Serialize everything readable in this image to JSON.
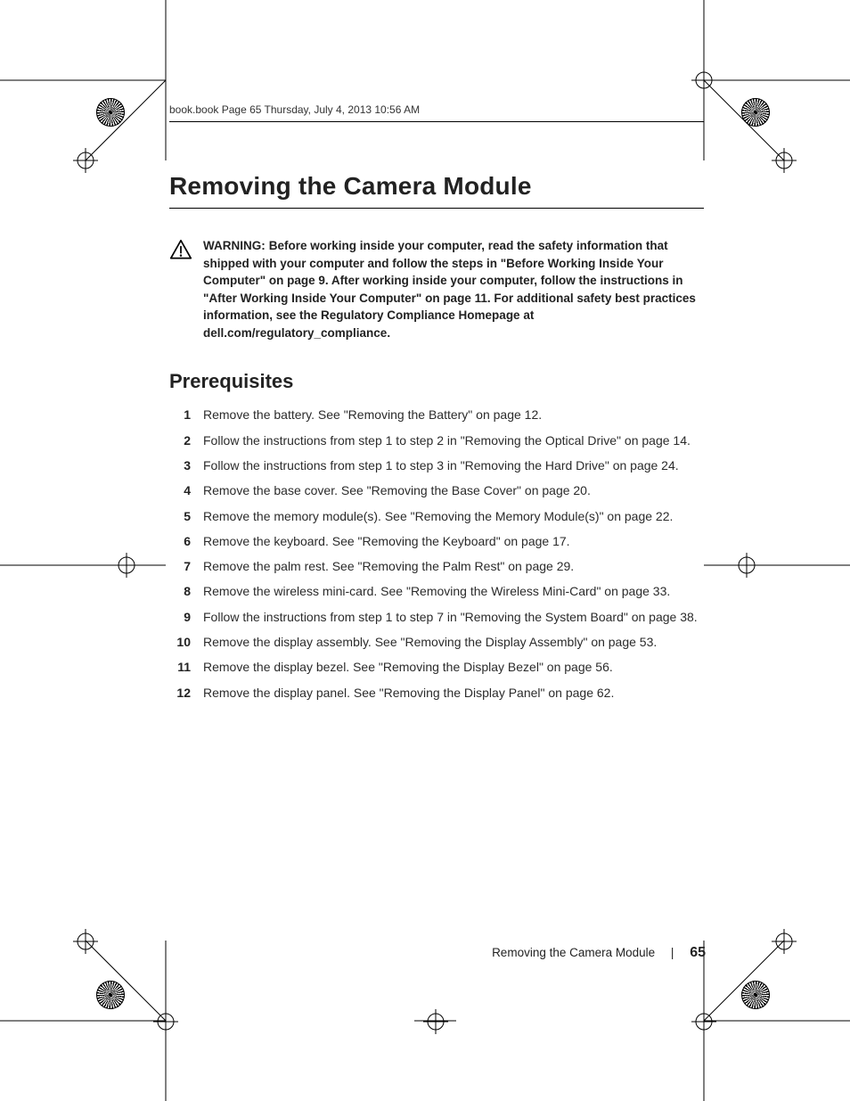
{
  "running_header": "book.book  Page 65  Thursday, July 4, 2013  10:56 AM",
  "title": "Removing the Camera Module",
  "warning": {
    "label": "WARNING:",
    "body": "Before working inside your computer, read the safety information that shipped with your computer and follow the steps in \"Before Working Inside Your Computer\" on page 9. After working inside your computer, follow the instructions in \"After Working Inside Your Computer\" on page 11. For additional safety best practices information, see the Regulatory Compliance Homepage at dell.com/regulatory_compliance."
  },
  "section_heading": "Prerequisites",
  "steps": [
    {
      "n": "1",
      "t": "Remove the battery. See \"Removing the Battery\" on page 12."
    },
    {
      "n": "2",
      "t": "Follow the instructions from step 1 to step 2 in \"Removing the Optical Drive\" on page 14."
    },
    {
      "n": "3",
      "t": "Follow the instructions from step 1 to step 3 in \"Removing the Hard Drive\" on page 24."
    },
    {
      "n": "4",
      "t": "Remove the base cover. See \"Removing the Base Cover\" on page 20."
    },
    {
      "n": "5",
      "t": "Remove the memory module(s). See \"Removing the Memory Module(s)\" on page 22."
    },
    {
      "n": "6",
      "t": "Remove the keyboard. See \"Removing the Keyboard\" on page 17."
    },
    {
      "n": "7",
      "t": "Remove the palm rest. See \"Removing the Palm Rest\" on page 29."
    },
    {
      "n": "8",
      "t": "Remove the wireless mini-card. See \"Removing the Wireless Mini-Card\" on page 33."
    },
    {
      "n": "9",
      "t": "Follow the instructions from step 1 to step 7 in \"Removing the System Board\" on page 38."
    },
    {
      "n": "10",
      "t": "Remove the display assembly. See \"Removing the Display Assembly\" on page 53."
    },
    {
      "n": "11",
      "t": "Remove the display bezel. See \"Removing the Display Bezel\" on page 56."
    },
    {
      "n": "12",
      "t": "Remove the display panel. See \"Removing the Display Panel\" on page 62."
    }
  ],
  "footer": {
    "label": "Removing the Camera Module",
    "sep": "|",
    "page": "65"
  }
}
